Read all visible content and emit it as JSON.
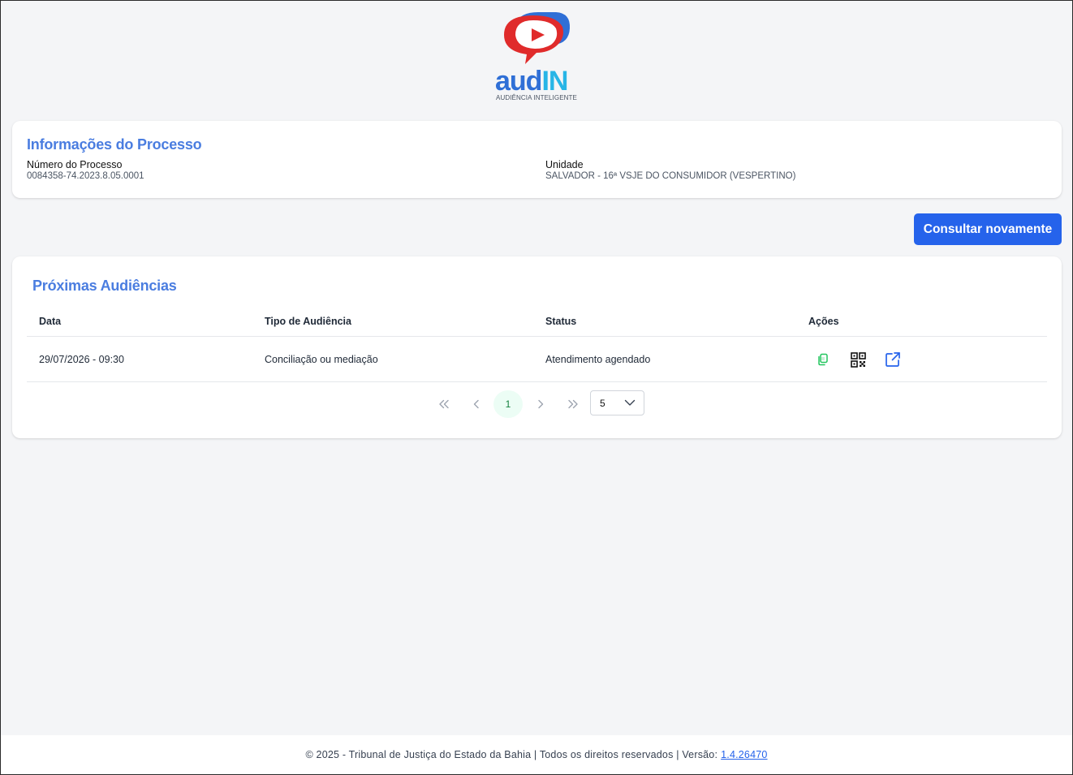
{
  "logo": {
    "wordmark": "audIN",
    "tagline": "AUDIÊNCIA INTELIGENTE"
  },
  "info_card": {
    "title": "Informações do Processo",
    "numero_label": "Número do Processo",
    "numero_value": "0084358-74.2023.8.05.0001",
    "unidade_label": "Unidade",
    "unidade_value": "SALVADOR - 16ª VSJE DO CONSUMIDOR (VESPERTINO)"
  },
  "consultar_button": "Consultar novamente",
  "audiencias": {
    "title": "Próximas Audiências",
    "columns": [
      "Data",
      "Tipo de Audiência",
      "Status",
      "Ações"
    ],
    "rows": [
      {
        "data": "29/07/2026 - 09:30",
        "tipo": "Conciliação ou mediação",
        "status": "Atendimento agendado",
        "actions": [
          "copy-icon",
          "qr-code-icon",
          "external-link-icon"
        ]
      }
    ],
    "pagination": {
      "current_page": "1",
      "page_size": "5"
    }
  },
  "footer": {
    "text": "© 2025 - Tribunal de Justiça do Estado da Bahia | Todos os direitos reservados | Versão:",
    "version": "1.4.26470"
  },
  "colors": {
    "accent": "#2563eb",
    "title": "#4a7de0",
    "logo_red": "#e02b2b",
    "logo_blue": "#2f6fd6",
    "logo_cyan": "#27b5e6",
    "copy_green": "#22c55e"
  }
}
